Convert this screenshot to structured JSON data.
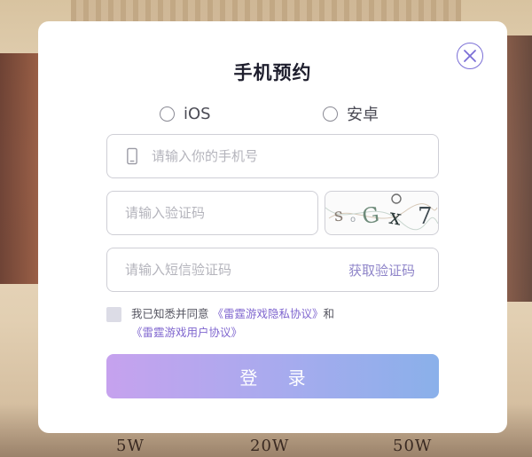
{
  "background": {
    "tiers": [
      "5W",
      "20W",
      "50W"
    ]
  },
  "modal": {
    "title": "手机预约",
    "close_icon": "close-circle-icon",
    "platforms": [
      {
        "label": "iOS",
        "selected": false
      },
      {
        "label": "安卓",
        "selected": false
      }
    ],
    "phone": {
      "placeholder": "请输入你的手机号",
      "value": "",
      "icon": "mobile-phone-icon"
    },
    "captcha": {
      "placeholder": "请输入验证码",
      "value": "",
      "image_text": "s G x 7"
    },
    "sms": {
      "placeholder": "请输入短信验证码",
      "value": "",
      "get_code_label": "获取验证码"
    },
    "agreement": {
      "checked": false,
      "prefix": "我已知悉并同意 ",
      "privacy_link": "《雷霆游戏隐私协议》",
      "conjunction": "和",
      "user_link": "《雷霆游戏用户协议》"
    },
    "login_label": "登 录"
  },
  "colors": {
    "accent": "#7b6fd6",
    "link": "#7f66cf",
    "button_gradient_start": "#c6a2ee",
    "button_gradient_end": "#8ab0ea"
  }
}
